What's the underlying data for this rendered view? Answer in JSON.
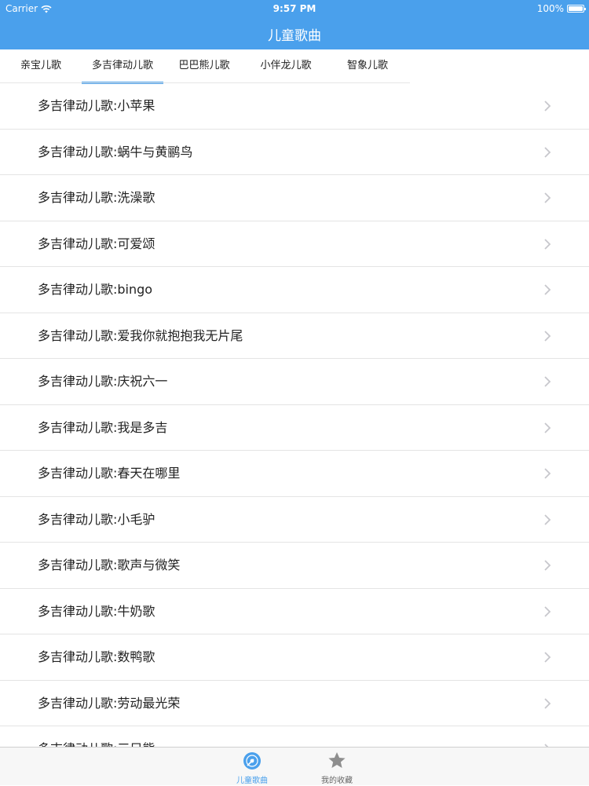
{
  "status_bar": {
    "carrier": "Carrier",
    "time": "9:57 PM",
    "battery": "100%"
  },
  "nav": {
    "title": "儿童歌曲"
  },
  "tabs": [
    {
      "label": "亲宝儿歌"
    },
    {
      "label": "多吉律动儿歌",
      "active": true
    },
    {
      "label": "巴巴熊儿歌"
    },
    {
      "label": "小伴龙儿歌"
    },
    {
      "label": "智象儿歌"
    }
  ],
  "songs": [
    "多吉律动儿歌:小苹果",
    "多吉律动儿歌:蜗牛与黄鹂鸟",
    "多吉律动儿歌:洗澡歌",
    "多吉律动儿歌:可爱颂",
    "多吉律动儿歌:bingo",
    "多吉律动儿歌:爱我你就抱抱我无片尾",
    "多吉律动儿歌:庆祝六一",
    "多吉律动儿歌:我是多吉",
    "多吉律动儿歌:春天在哪里",
    "多吉律动儿歌:小毛驴",
    "多吉律动儿歌:歌声与微笑",
    "多吉律动儿歌:牛奶歌",
    "多吉律动儿歌:数鸭歌",
    "多吉律动儿歌:劳动最光荣",
    "多吉律动儿歌:三只熊"
  ],
  "tabbar": [
    {
      "label": "儿童歌曲",
      "icon": "music-disc-icon",
      "active": true
    },
    {
      "label": "我的收藏",
      "icon": "star-icon",
      "active": false
    }
  ],
  "colors": {
    "accent": "#4aa0ec",
    "inactive": "#8e8e8e",
    "separator": "#e4e4e4"
  }
}
